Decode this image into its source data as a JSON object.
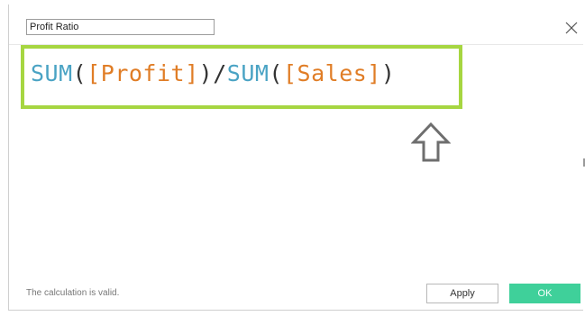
{
  "dialog": {
    "calculation_name": "Profit Ratio",
    "close_icon": "close-icon"
  },
  "formula": {
    "fn1": "SUM",
    "open1": "(",
    "field1": "[Profit]",
    "close1": ")",
    "slash": "/",
    "fn2": "SUM",
    "open2": "(",
    "field2": "[Sales]",
    "close2": ")"
  },
  "annotation": {
    "arrow_icon": "up-arrow-outline-icon",
    "highlight_color": "#a6d641"
  },
  "footer": {
    "status": "The calculation is valid.",
    "apply_label": "Apply",
    "ok_label": "OK"
  },
  "colors": {
    "function": "#4aa3c4",
    "field": "#e07d26",
    "ok_button": "#3fd09a"
  }
}
